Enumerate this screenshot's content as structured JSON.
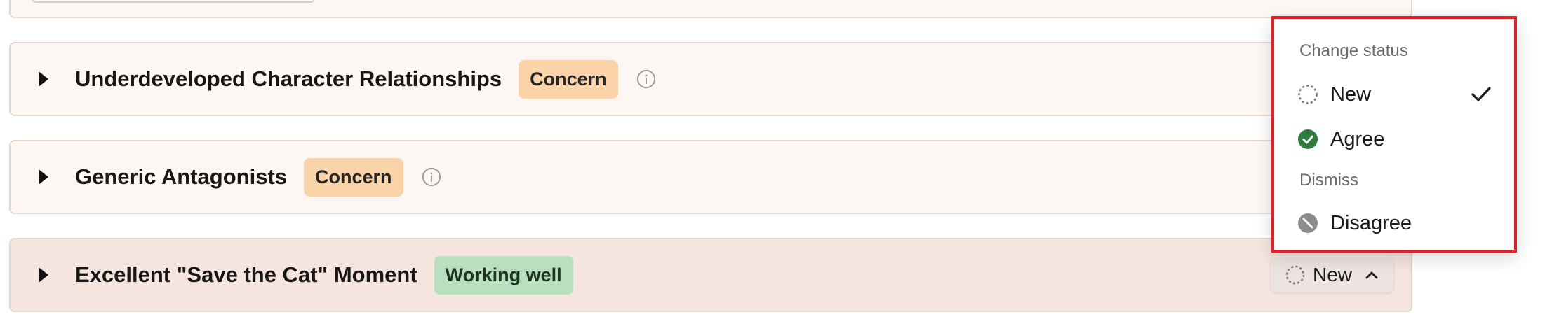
{
  "feedback_items": [
    {
      "title": "Underdeveloped Character Relationships",
      "badge": "Concern"
    },
    {
      "title": "Generic Antagonists",
      "badge": "Concern"
    },
    {
      "title": "Excellent \"Save the Cat\" Moment",
      "badge": "Working well"
    }
  ],
  "status_button": {
    "label": "New"
  },
  "status_menu": {
    "section_change": "Change status",
    "item_new": "New",
    "item_agree": "Agree",
    "section_dismiss": "Dismiss",
    "item_disagree": "Disagree",
    "selected": "New"
  },
  "colors": {
    "concern_badge": "#fbd3a8",
    "working_well_badge": "#b8dfbe",
    "agree_icon": "#2e7d3e",
    "disagree_icon": "#8c8c8c",
    "highlight_border": "#e0202a"
  },
  "icons": {
    "expand": "caret-right-icon",
    "info": "info-icon",
    "status_new": "dashed-circle-icon",
    "status_agree": "check-circle-icon",
    "status_disagree": "slash-circle-icon",
    "selected": "checkmark-icon",
    "collapse": "chevron-up-icon"
  }
}
